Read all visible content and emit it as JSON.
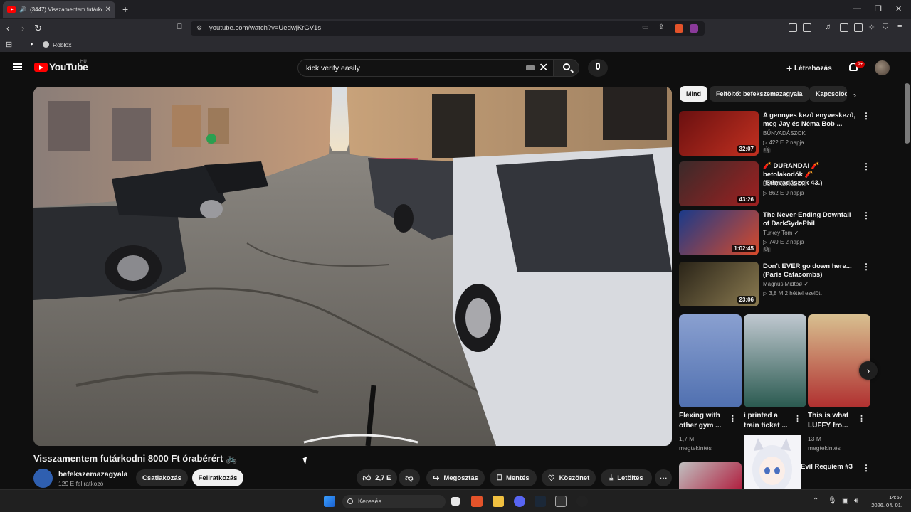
{
  "browser": {
    "tab_title": "(3447) Visszamentem futárko",
    "url": "youtube.com/watch?v=UedwjKrGV1s",
    "bookmark_label": "Roblox"
  },
  "header": {
    "logo_text": "YouTube",
    "country_code": "HU",
    "search_value": "kick verify easily",
    "create_label": "Létrehozás",
    "notifications_count": "9+"
  },
  "video": {
    "title": "Visszamentem futárkodni 8000 Ft órabérért 🚲",
    "channel_name": "befekszemazagyala",
    "subscribers": "129 E feliratkozó",
    "join_label": "Csatlakozás",
    "subscribe_label": "Feliratkozás",
    "likes": "2,7 E",
    "share_label": "Megosztás",
    "save_label": "Mentés",
    "thanks_label": "Köszönet",
    "download_label": "Letöltés"
  },
  "chips": [
    "Mind",
    "Feltöltő: befekszemazagyala",
    "Kapcsolód"
  ],
  "recommendations": [
    {
      "title": "A gennyes kezű enyveskezű, meg Jay és Néma Bob ...",
      "channel": "BŰNVADÁSZOK",
      "meta": "▷ 422 E  2 napja",
      "duration": "32:07",
      "badge": "Új",
      "colors": [
        "#6a1010",
        "#c23020"
      ]
    },
    {
      "title": "🧨 DURANDAI 🧨 betolakodók 🧨 (Bűnvadászok 43.)",
      "channel": "BŰNVADÁSZOK",
      "meta": "▷ 862 E  9 napja",
      "duration": "43:26",
      "badge": "",
      "colors": [
        "#3a2a2a",
        "#a02020"
      ]
    },
    {
      "title": "The Never-Ending Downfall of DarkSydePhil",
      "channel": "Turkey Tom ✓",
      "meta": "▷ 749 E  2 napja",
      "duration": "1:02:45",
      "badge": "Új",
      "colors": [
        "#1a3a8a",
        "#d84a2a"
      ]
    },
    {
      "title": "Don't EVER go down here... (Paris Catacombs)",
      "channel": "Magnus Midtbø ✓",
      "meta": "▷ 3,8 M  2 héttel ezelőtt",
      "duration": "23:06",
      "badge": "",
      "colors": [
        "#2a2418",
        "#8a7a50"
      ]
    }
  ],
  "shorts": [
    {
      "title": "Flexing with other gym ...",
      "views": "1,7 M",
      "views_label": "megtekintés",
      "colors": [
        "#8aa0d0",
        "#5070b0"
      ]
    },
    {
      "title": "i printed a train ticket ...",
      "views": "",
      "views_label": "",
      "colors": [
        "#c0c8d0",
        "#2a5a50"
      ]
    },
    {
      "title": "This is what LUFFY fro...",
      "views": "13 M",
      "views_label": "megtekintés",
      "colors": [
        "#d8c090",
        "#b03030"
      ]
    }
  ],
  "partial_rec_title": "Evil Requiem #3",
  "taskbar": {
    "search_placeholder": "Keresés",
    "time": "14:57",
    "date": "2026. 04. 01."
  }
}
